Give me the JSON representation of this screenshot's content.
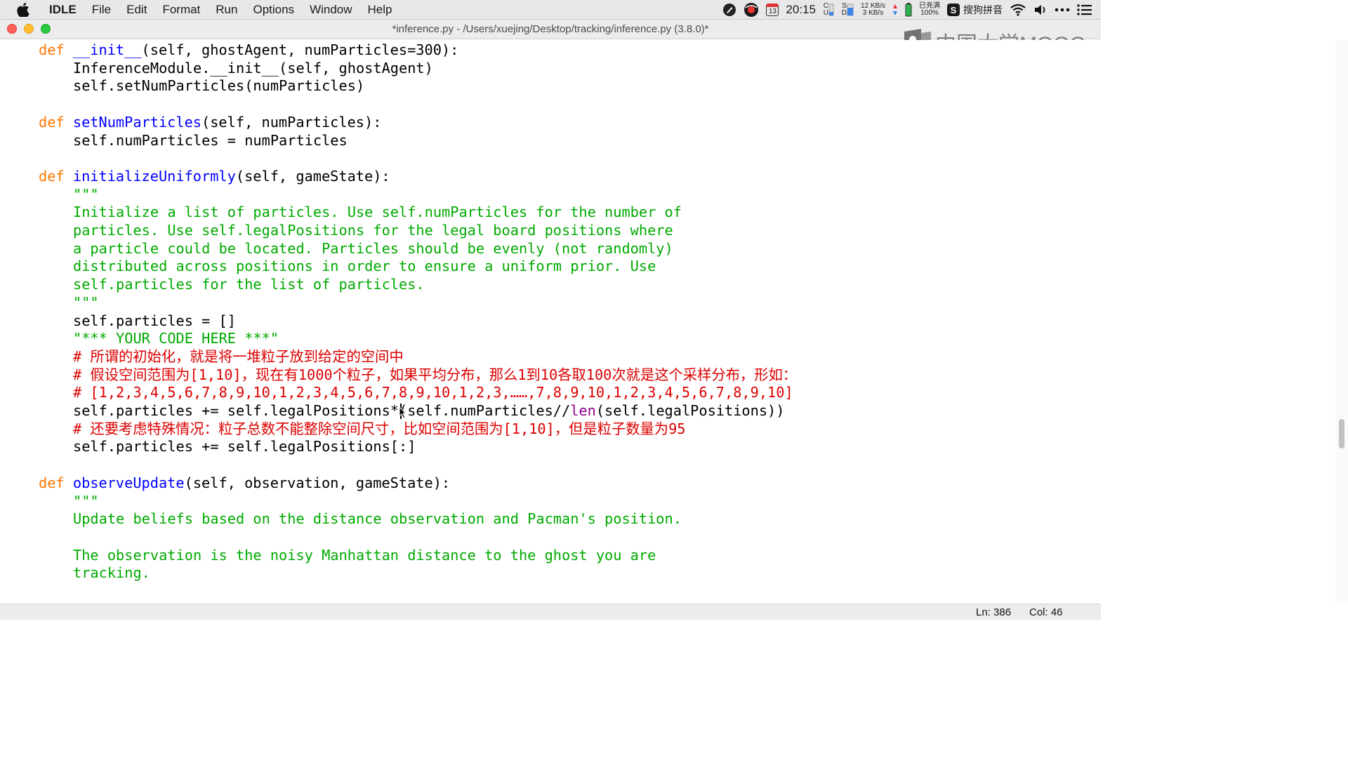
{
  "menubar": {
    "app": "IDLE",
    "items": [
      "File",
      "Edit",
      "Format",
      "Run",
      "Options",
      "Window",
      "Help"
    ],
    "calendar_day": "13",
    "time": "20:15",
    "network_up": "12 KB/s",
    "network_down": "3 KB/s",
    "battery_line1": "已充满",
    "battery_line2": "100%",
    "ime_label": "搜狗拼音",
    "ime_badge": "S",
    "cpu_labels": "C\nU",
    "disk_labels": "S\nD"
  },
  "window": {
    "title": "*inference.py - /Users/xuejing/Desktop/tracking/inference.py (3.8.0)*"
  },
  "watermark": {
    "text": "中国大学MOOC"
  },
  "code": {
    "l1_kw": "def",
    "l1_name": "__init__",
    "l1_rest": "(self, ghostAgent, numParticles=300):",
    "l2": "InferenceModule.__init__(self, ghostAgent)",
    "l3": "self.setNumParticles(numParticles)",
    "l5_kw": "def",
    "l5_name": "setNumParticles",
    "l5_rest": "(self, numParticles):",
    "l6": "self.numParticles = numParticles",
    "l8_kw": "def",
    "l8_name": "initializeUniformly",
    "l8_rest": "(self, gameState):",
    "l9": "\"\"\"",
    "l10": "Initialize a list of particles. Use self.numParticles for the number of",
    "l11": "particles. Use self.legalPositions for the legal board positions where",
    "l12": "a particle could be located. Particles should be evenly (not randomly)",
    "l13": "distributed across positions in order to ensure a uniform prior. Use",
    "l14": "self.particles for the list of particles.",
    "l15": "\"\"\"",
    "l16": "self.particles = []",
    "l17": "\"*** YOUR CODE HERE ***\"",
    "l18": "# 所谓的初始化，就是将一堆粒子放到给定的空间中",
    "l19": "# 假设空间范围为[1,10]，现在有1000个粒子，如果平均分布，那么1到10各取100次就是这个采样分布，形如：",
    "l20": "# [1,2,3,4,5,6,7,8,9,10,1,2,3,4,5,6,7,8,9,10,1,2,3,……,7,8,9,10,1,2,3,4,5,6,7,8,9,10]",
    "l21_a": "self.particles += self.legalPositions*(self.numParticles//",
    "l21_bi": "len",
    "l21_b": "(self.legalPositions))",
    "l22": "# 还要考虑特殊情况：粒子总数不能整除空间尺寸，比如空间范围为[1,10]，但是粒子数量为95",
    "l23": "self.particles += self.legalPositions[:]",
    "l25_kw": "def",
    "l25_name": "observeUpdate",
    "l25_rest": "(self, observation, gameState):",
    "l26": "\"\"\"",
    "l27": "Update beliefs based on the distance observation and Pacman's position.",
    "l29": "The observation is the noisy Manhattan distance to the ghost you are",
    "l30": "tracking."
  },
  "status": {
    "ln": "Ln: 386",
    "col": "Col: 46"
  },
  "colors": {
    "keyword": "#ff7700",
    "definition": "#0000ff",
    "string": "#00aa00",
    "comment": "#dd0000",
    "builtin": "#900090"
  }
}
